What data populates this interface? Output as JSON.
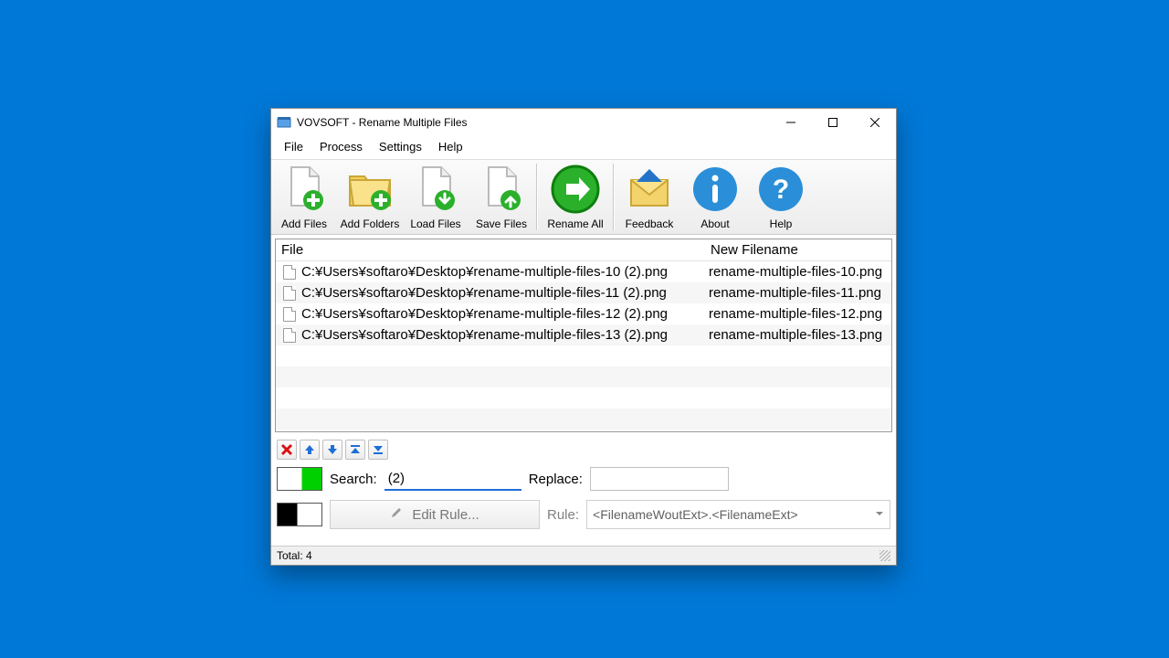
{
  "title": "VOVSOFT - Rename Multiple Files",
  "menu": [
    "File",
    "Process",
    "Settings",
    "Help"
  ],
  "toolbar": [
    {
      "id": "add-files",
      "label": "Add Files"
    },
    {
      "id": "add-folders",
      "label": "Add Folders"
    },
    {
      "id": "load-files",
      "label": "Load Files"
    },
    {
      "id": "save-files",
      "label": "Save Files"
    },
    {
      "id": "rename-all",
      "label": "Rename All"
    },
    {
      "id": "feedback",
      "label": "Feedback"
    },
    {
      "id": "about",
      "label": "About"
    },
    {
      "id": "help",
      "label": "Help"
    }
  ],
  "columns": {
    "file": "File",
    "new": "New Filename"
  },
  "rows": [
    {
      "file": "C:¥Users¥softaro¥Desktop¥rename-multiple-files-10 (2).png",
      "new": "rename-multiple-files-10.png"
    },
    {
      "file": "C:¥Users¥softaro¥Desktop¥rename-multiple-files-11 (2).png",
      "new": "rename-multiple-files-11.png"
    },
    {
      "file": "C:¥Users¥softaro¥Desktop¥rename-multiple-files-12 (2).png",
      "new": "rename-multiple-files-12.png"
    },
    {
      "file": "C:¥Users¥softaro¥Desktop¥rename-multiple-files-13 (2).png",
      "new": "rename-multiple-files-13.png"
    }
  ],
  "search_label": "Search:",
  "search_value": "(2)",
  "replace_label": "Replace:",
  "replace_value": "",
  "edit_rule_label": "Edit Rule...",
  "rule_label": "Rule:",
  "rule_value": "<FilenameWoutExt>.<FilenameExt>",
  "status": "Total: 4"
}
